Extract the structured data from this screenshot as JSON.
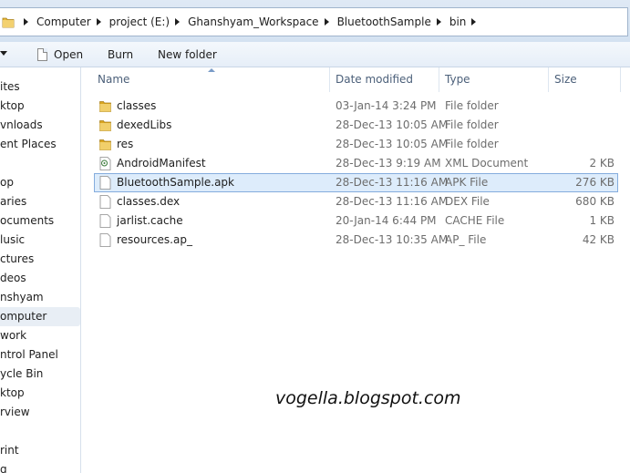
{
  "address_bar": {
    "crumbs": [
      "Computer",
      "project (E:)",
      "Ghanshyam_Workspace",
      "BluetoothSample",
      "bin"
    ]
  },
  "toolbar": {
    "open_label": "Open",
    "burn_label": "Burn",
    "new_folder_label": "New folder"
  },
  "nav": {
    "items": [
      "ites",
      "ktop",
      "vnloads",
      "ent Places",
      "",
      "op",
      "aries",
      "ocuments",
      "lusic",
      "ctures",
      "deos",
      "nshyam",
      "omputer",
      "work",
      "ntrol Panel",
      "ycle Bin",
      "ktop",
      "rview",
      "",
      "rint",
      "g"
    ],
    "selected_index": 12
  },
  "columns": {
    "name": "Name",
    "date": "Date modified",
    "type": "Type",
    "size": "Size"
  },
  "files": [
    {
      "name": "classes",
      "date": "03-Jan-14 3:24 PM",
      "type": "File folder",
      "size": "",
      "icon": "folder-icon"
    },
    {
      "name": "dexedLibs",
      "date": "28-Dec-13 10:05 AM",
      "type": "File folder",
      "size": "",
      "icon": "folder-icon"
    },
    {
      "name": "res",
      "date": "28-Dec-13 10:05 AM",
      "type": "File folder",
      "size": "",
      "icon": "folder-icon"
    },
    {
      "name": "AndroidManifest",
      "date": "28-Dec-13 9:19 AM",
      "type": "XML Document",
      "size": "2 KB",
      "icon": "xml-document-icon"
    },
    {
      "name": "BluetoothSample.apk",
      "date": "28-Dec-13 11:16 AM",
      "type": "APK File",
      "size": "276 KB",
      "icon": "file-icon"
    },
    {
      "name": "classes.dex",
      "date": "28-Dec-13 11:16 AM",
      "type": "DEX File",
      "size": "680 KB",
      "icon": "file-icon"
    },
    {
      "name": "jarlist.cache",
      "date": "20-Jan-14 6:44 PM",
      "type": "CACHE File",
      "size": "1 KB",
      "icon": "file-icon"
    },
    {
      "name": "resources.ap_",
      "date": "28-Dec-13 10:35 AM",
      "type": "AP_ File",
      "size": "42 KB",
      "icon": "file-icon"
    }
  ],
  "selected_file_index": 4,
  "watermark": "vogella.blogspot.com",
  "colors": {
    "selection_fill": "#ddecfb",
    "selection_border": "#84acdd",
    "folder": "#e8b93a"
  }
}
